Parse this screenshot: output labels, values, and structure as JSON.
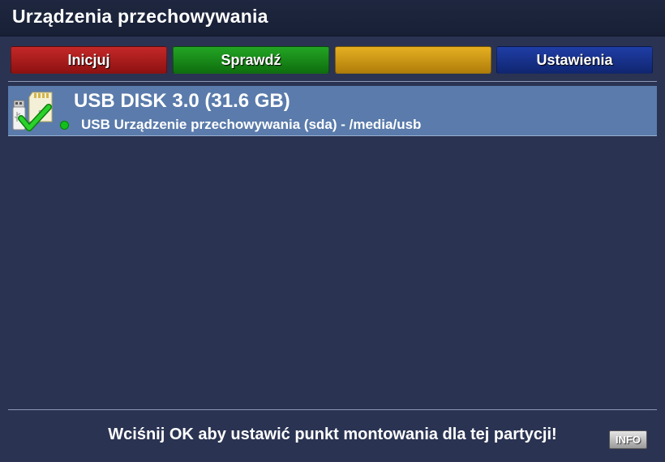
{
  "window": {
    "title": "Urządzenia przechowywania"
  },
  "toolbar": {
    "red_label": "Inicjuj",
    "green_label": "Sprawdź",
    "yellow_label": "",
    "blue_label": "Ustawienia"
  },
  "devices": [
    {
      "name": "USB DISK 3.0 (31.6 GB)",
      "description": "USB Urządzenie przechowywania (sda) - /media/usb",
      "icon": "usb-sd-storage-check-icon",
      "status_color": "#13c01b"
    }
  ],
  "footer": {
    "hint": "Wciśnij OK aby ustawić punkt montowania dla tej partycji!",
    "info_label": "INFO"
  },
  "colors": {
    "background": "#2a3352",
    "selected_row": "#5a7bab",
    "red": "#b01d1d",
    "green": "#199a19",
    "yellow": "#d9a018",
    "blue": "#183590"
  }
}
